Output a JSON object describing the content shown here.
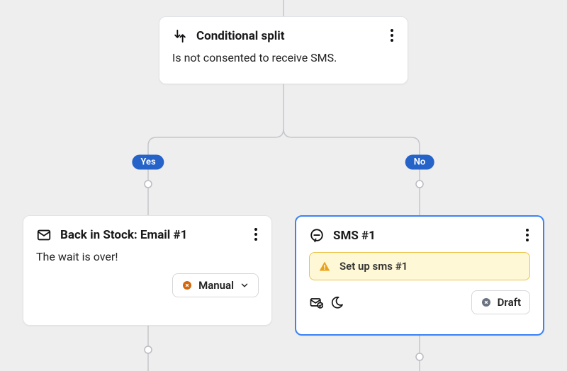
{
  "split": {
    "title": "Conditional split",
    "desc": "Is not consented to receive SMS."
  },
  "branches": {
    "yes": "Yes",
    "no": "No"
  },
  "email": {
    "title": "Back in Stock: Email #1",
    "desc": "The wait is over!",
    "button": "Manual"
  },
  "sms": {
    "title": "SMS #1",
    "warning": "Set up sms #1",
    "status": "Draft"
  }
}
